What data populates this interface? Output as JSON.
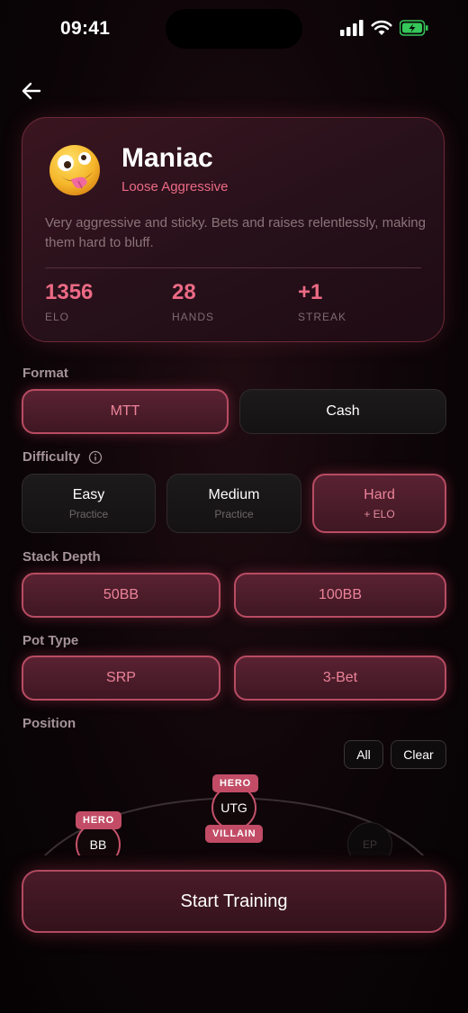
{
  "status_bar": {
    "time": "09:41"
  },
  "profile": {
    "name": "Maniac",
    "style": "Loose Aggressive",
    "description": "Very aggressive and sticky. Bets and raises relentlessly, making them hard to bluff.",
    "stats": [
      {
        "value": "1356",
        "label": "ELO"
      },
      {
        "value": "28",
        "label": "HANDS"
      },
      {
        "value": "+1",
        "label": "STREAK"
      }
    ]
  },
  "format": {
    "label": "Format",
    "options": [
      {
        "label": "MTT",
        "selected": true
      },
      {
        "label": "Cash",
        "selected": false
      }
    ]
  },
  "difficulty": {
    "label": "Difficulty",
    "options": [
      {
        "label": "Easy",
        "sub": "Practice",
        "selected": false
      },
      {
        "label": "Medium",
        "sub": "Practice",
        "selected": false
      },
      {
        "label": "Hard",
        "sub": "+ ELO",
        "selected": true
      }
    ]
  },
  "stack_depth": {
    "label": "Stack Depth",
    "options": [
      {
        "label": "50BB",
        "selected": true
      },
      {
        "label": "100BB",
        "selected": true
      }
    ]
  },
  "pot_type": {
    "label": "Pot Type",
    "options": [
      {
        "label": "SRP",
        "selected": true
      },
      {
        "label": "3-Bet",
        "selected": true
      }
    ]
  },
  "position": {
    "label": "Position",
    "all_label": "All",
    "clear_label": "Clear",
    "seats": [
      {
        "name": "BB",
        "badges": [
          "HERO"
        ]
      },
      {
        "name": "UTG",
        "badges": [
          "HERO",
          "VILLAIN"
        ]
      },
      {
        "name": "EP",
        "badges": []
      }
    ]
  },
  "start_label": "Start Training",
  "colors": {
    "accent": "#ec6a85",
    "accent_border": "#b84c63",
    "background": "#0d0508"
  },
  "icons": [
    "back-arrow-icon",
    "info-icon",
    "signal-icon",
    "wifi-icon",
    "battery-icon",
    "crazy-face-emoji"
  ]
}
